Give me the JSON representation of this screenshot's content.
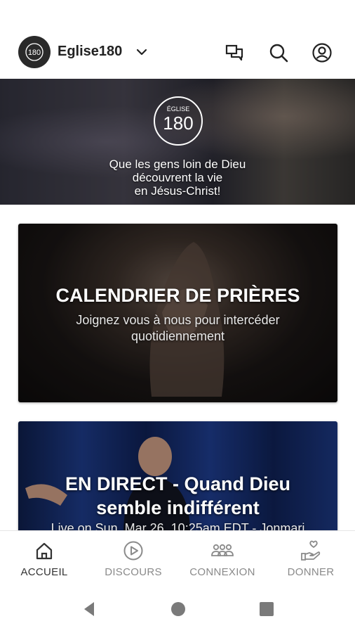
{
  "header": {
    "church_name": "Eglise180",
    "logo_text": "180",
    "icons": [
      "chat-icon",
      "search-icon",
      "account-icon"
    ]
  },
  "hero": {
    "logo_small_text": "ÉGLISE",
    "logo_number": "180",
    "tagline_lines": [
      "Que les gens loin de Dieu",
      "découvrent la vie",
      "en Jésus-Christ!"
    ]
  },
  "cards": [
    {
      "title": "CALENDRIER DE PRIÈRES",
      "subtitle_lines": [
        "Joignez vous à nous pour intercéder",
        "quotidiennement"
      ]
    },
    {
      "title_lines": [
        "EN DIRECT - Quand Dieu",
        "semble indifférent"
      ],
      "subtitle": "Live on Sun, Mar 26, 10:25am EDT - Jonmari"
    }
  ],
  "bottom_nav": [
    {
      "label": "ACCUEIL",
      "icon": "home-icon",
      "active": true
    },
    {
      "label": "DISCOURS",
      "icon": "play-circle-icon",
      "active": false
    },
    {
      "label": "CONNEXION",
      "icon": "people-icon",
      "active": false
    },
    {
      "label": "DONNER",
      "icon": "give-heart-icon",
      "active": false
    }
  ],
  "colors": {
    "active_nav": "#333333",
    "inactive_nav": "#8a8a8a",
    "live_card_blue": "#1d3a86"
  }
}
